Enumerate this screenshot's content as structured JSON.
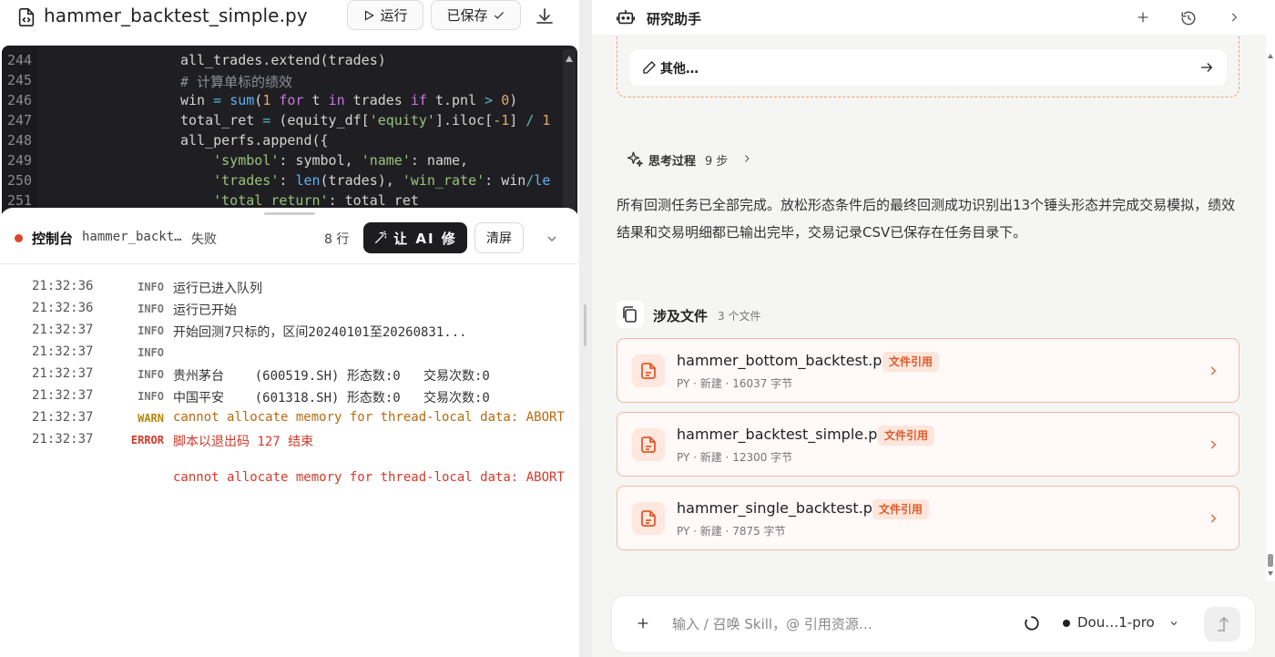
{
  "editor": {
    "file_title": "hammer_backtest_simple.py",
    "run_label": "运行",
    "saved_label": "已保存",
    "lines": [
      {
        "n": "244",
        "indent": "",
        "parts": [
          {
            "t": "all_trades.extend(trades)",
            "c": ""
          }
        ]
      },
      {
        "n": "245",
        "indent": "",
        "parts": [
          {
            "t": "# 计算单标的绩效",
            "c": "cm"
          }
        ]
      },
      {
        "n": "246",
        "indent": "",
        "parts": [
          {
            "t": "win",
            "c": ""
          },
          {
            "t": " = ",
            "c": "op"
          },
          {
            "t": "sum",
            "c": "fn"
          },
          {
            "t": "(",
            "c": ""
          },
          {
            "t": "1",
            "c": "num"
          },
          {
            "t": " for ",
            "c": "kw"
          },
          {
            "t": "t ",
            "c": ""
          },
          {
            "t": "in",
            "c": "kw"
          },
          {
            "t": " trades ",
            "c": ""
          },
          {
            "t": "if",
            "c": "kw"
          },
          {
            "t": " t.pnl ",
            "c": ""
          },
          {
            "t": ">",
            "c": "op"
          },
          {
            "t": " ",
            "c": ""
          },
          {
            "t": "0",
            "c": "num"
          },
          {
            "t": ")",
            "c": ""
          }
        ]
      },
      {
        "n": "247",
        "indent": "",
        "parts": [
          {
            "t": "total_ret",
            "c": ""
          },
          {
            "t": " = ",
            "c": "op"
          },
          {
            "t": "(equity_df[",
            "c": ""
          },
          {
            "t": "'equity'",
            "c": "str"
          },
          {
            "t": "].iloc[",
            "c": ""
          },
          {
            "t": "-1",
            "c": "num"
          },
          {
            "t": "] ",
            "c": ""
          },
          {
            "t": "/",
            "c": "op"
          },
          {
            "t": " 1",
            "c": "num"
          }
        ]
      },
      {
        "n": "248",
        "indent": "",
        "parts": [
          {
            "t": "all_perfs.append({",
            "c": ""
          }
        ]
      },
      {
        "n": "249",
        "indent": "    ",
        "parts": [
          {
            "t": "'symbol'",
            "c": "str"
          },
          {
            "t": ": symbol, ",
            "c": ""
          },
          {
            "t": "'name'",
            "c": "str"
          },
          {
            "t": ": name,",
            "c": ""
          }
        ]
      },
      {
        "n": "250",
        "indent": "    ",
        "parts": [
          {
            "t": "'trades'",
            "c": "str"
          },
          {
            "t": ": ",
            "c": ""
          },
          {
            "t": "len",
            "c": "fn"
          },
          {
            "t": "(trades), ",
            "c": ""
          },
          {
            "t": "'win_rate'",
            "c": "str"
          },
          {
            "t": ": win",
            "c": ""
          },
          {
            "t": "/",
            "c": "op"
          },
          {
            "t": "le",
            "c": "fn"
          }
        ]
      },
      {
        "n": "251",
        "indent": "    ",
        "parts": [
          {
            "t": "'total_return'",
            "c": "str"
          },
          {
            "t": ": total_ret",
            "c": ""
          }
        ]
      }
    ]
  },
  "console": {
    "title": "控制台",
    "file": "hammer_backt…",
    "status": "失败",
    "line_count": "8 行",
    "ai_fix_label": "让 AI 修",
    "clear_label": "清屏",
    "logs": [
      {
        "time": "21:32:36",
        "level": "INFO",
        "msg": "运行已进入队列"
      },
      {
        "time": "21:32:36",
        "level": "INFO",
        "msg": "运行已开始"
      },
      {
        "time": "21:32:37",
        "level": "INFO",
        "msg": "开始回测7只标的，区间20240101至20260831..."
      },
      {
        "time": "21:32:37",
        "level": "INFO",
        "msg": ""
      },
      {
        "time": "21:32:37",
        "level": "INFO",
        "msg": "贵州茅台    (600519.SH) 形态数:0   交易次数:0"
      },
      {
        "time": "21:32:37",
        "level": "INFO",
        "msg": "中国平安    (601318.SH) 形态数:0   交易次数:0"
      },
      {
        "time": "21:32:37",
        "level": "WARN",
        "msg": "cannot allocate memory for thread-local data: ABORT"
      },
      {
        "time": "21:32:37",
        "level": "ERROR",
        "msg": "脚本以退出码 127 结束"
      }
    ],
    "error_detail": "cannot allocate memory for thread-local data: ABORT"
  },
  "assistant": {
    "title": "研究助手",
    "other_label": "其他…",
    "thinking_label": "思考过程",
    "thinking_steps": "9 步",
    "summary": "所有回测任务已全部完成。放松形态条件后的最终回测成功识别出13个锤头形态并完成交易模拟，绩效结果和交易明细都已输出完毕，交易记录CSV已保存在任务目录下。",
    "files_title": "涉及文件",
    "files_count": "3 个文件",
    "files": [
      {
        "name": "hammer_bottom_backtest.py",
        "badge": "文件引用",
        "meta": "PY · 新建 · 16037 字节"
      },
      {
        "name": "hammer_backtest_simple.py",
        "badge": "文件引用",
        "meta": "PY · 新建 · 12300 字节"
      },
      {
        "name": "hammer_single_backtest.py",
        "badge": "文件引用",
        "meta": "PY · 新建 · 7875 字节"
      }
    ],
    "composer_placeholder": "输入 / 召唤 Skill，@ 引用资源…",
    "model_name": "Dou…1-pro"
  },
  "colors": {
    "accent": "#e05a2b",
    "error": "#d23a2a",
    "warn": "#b86a10",
    "editor_bg": "#1f1f23"
  }
}
